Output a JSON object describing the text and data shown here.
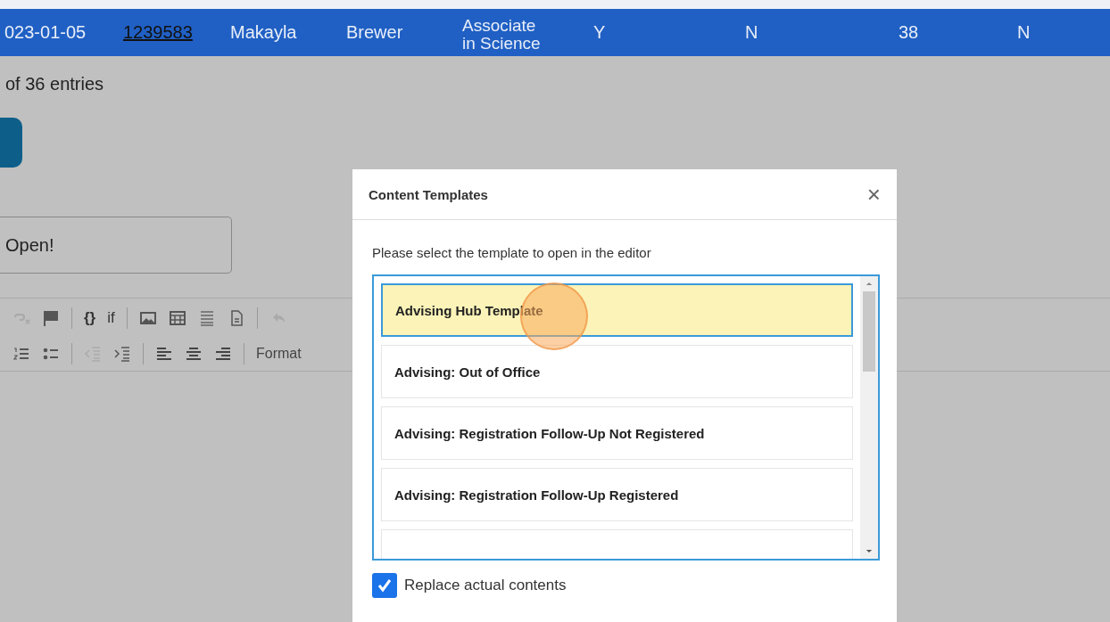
{
  "table_row": {
    "cells": [
      {
        "text": "023-01-05",
        "kind": "text"
      },
      {
        "text": "1239583",
        "kind": "link"
      },
      {
        "text": "Makayla",
        "kind": "text"
      },
      {
        "text": "Brewer",
        "kind": "text"
      },
      {
        "text": "Associate in Science",
        "kind": "text"
      },
      {
        "text": "Y",
        "kind": "text"
      },
      {
        "text": "N",
        "kind": "text"
      },
      {
        "text": "38",
        "kind": "text"
      },
      {
        "text": "N",
        "kind": "text"
      }
    ]
  },
  "entries_info": "of 36 entries",
  "subject_field": {
    "value": "Open!"
  },
  "toolbar": {
    "braces": "{}",
    "if": "if",
    "format": "Format"
  },
  "dialog": {
    "title": "Content Templates",
    "close": "×",
    "prompt": "Please select the template to open in the editor",
    "templates": [
      {
        "label": "Advising Hub Template",
        "selected": true
      },
      {
        "label": "Advising: Out of Office",
        "selected": false
      },
      {
        "label": "Advising: Registration Follow-Up Not Registered",
        "selected": false
      },
      {
        "label": "Advising: Registration Follow-Up Registered",
        "selected": false
      }
    ],
    "replace_checkbox": {
      "label": "Replace actual contents",
      "checked": true
    }
  }
}
